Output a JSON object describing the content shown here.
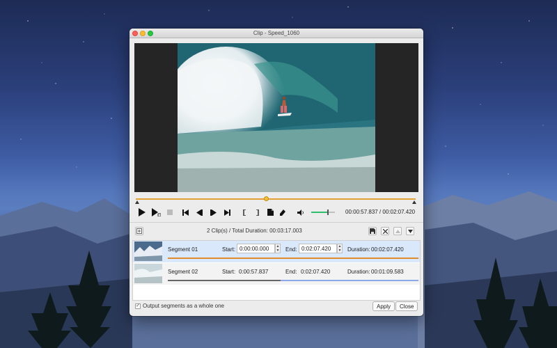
{
  "window": {
    "title": "Clip - Speed_1060"
  },
  "player": {
    "position_fraction": 0.465,
    "time_readout": "00:00:57.837 / 00:02:07.420",
    "volume_fraction": 0.72
  },
  "list_toolbar": {
    "summary": "2 Clip(s) /   Total Duration: 00:03:17.003"
  },
  "segment_labels": {
    "start": "Start:",
    "end": "End:",
    "duration": "Duration:"
  },
  "segments": [
    {
      "name": "Segment 01",
      "start": "0:00:00.000",
      "end": "0:02:07.420",
      "duration": "00:02:07.420",
      "selected": true
    },
    {
      "name": "Segment 02",
      "start": "0:00:57.837",
      "end": "0:02:07.420",
      "duration": "00:01:09.583",
      "selected": false,
      "progress_fraction": 0.45
    }
  ],
  "footer": {
    "output_whole": "Output segments as a whole one",
    "output_whole_checked": true,
    "apply": "Apply",
    "close": "Close"
  },
  "icons": {
    "play": "play-icon",
    "play_from": "play-segment-icon",
    "stop": "stop-icon",
    "prev": "skip-back-icon",
    "frame_back": "frame-back-icon",
    "frame_fwd": "frame-forward-icon",
    "next": "skip-forward-icon",
    "mark_in": "mark-in-icon",
    "mark_out": "mark-out-icon",
    "add": "add-segment-icon",
    "erase": "eraser-icon",
    "volume": "volume-icon"
  }
}
